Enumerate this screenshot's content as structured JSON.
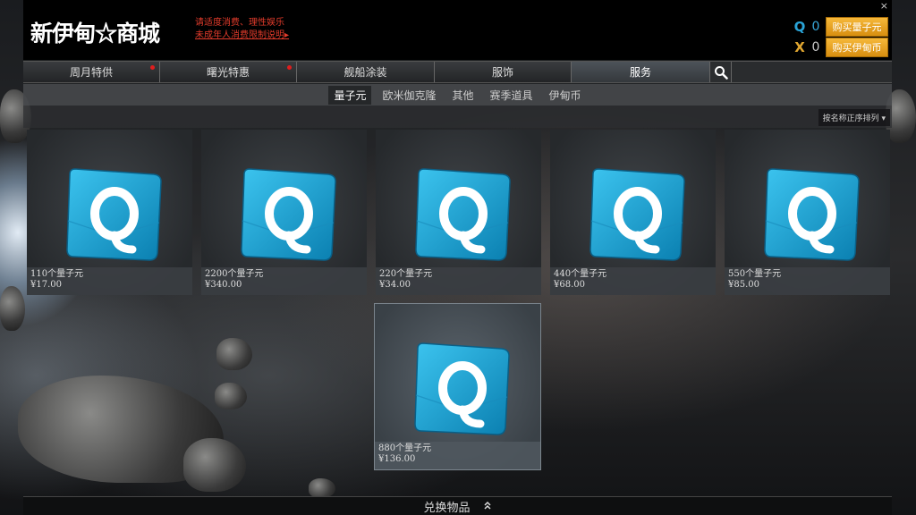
{
  "header": {
    "logo": "新伊甸☆商城",
    "notice_line1": "请适度消费、理性娱乐",
    "notice_line2": "未成年人消费限制说明",
    "notice_arrow": "▸",
    "close": "×",
    "currencies": [
      {
        "icon": "quantum-coin-icon",
        "symbol": "Q",
        "value": "0",
        "button": "购买量子元"
      },
      {
        "icon": "isk-coin-icon",
        "symbol": "X",
        "value": "0",
        "button": "购买伊甸币"
      }
    ]
  },
  "tabs": [
    {
      "label": "周月特供",
      "badge": true
    },
    {
      "label": "曙光特惠",
      "badge": true
    },
    {
      "label": "舰船涂装",
      "badge": false
    },
    {
      "label": "服饰",
      "badge": false
    },
    {
      "label": "服务",
      "badge": false,
      "active": true
    }
  ],
  "subtabs": [
    {
      "label": "量子元",
      "active": true
    },
    {
      "label": "欧米伽克隆"
    },
    {
      "label": "其他"
    },
    {
      "label": "赛季道具"
    },
    {
      "label": "伊甸币"
    }
  ],
  "sort": {
    "label": "按名称正序排列 ▾"
  },
  "products": [
    {
      "name": "110个量子元",
      "price": "¥17.00"
    },
    {
      "name": "2200个量子元",
      "price": "¥340.00"
    },
    {
      "name": "220个量子元",
      "price": "¥34.00"
    },
    {
      "name": "440个量子元",
      "price": "¥68.00"
    },
    {
      "name": "550个量子元",
      "price": "¥85.00"
    },
    {
      "name": "880个量子元",
      "price": "¥136.00",
      "selected": true
    }
  ],
  "footer": {
    "label": "兑换物品",
    "chevron": "⌃⌃"
  },
  "colors": {
    "accent": "#f0a62a",
    "badge": "#e01e1e",
    "quantum": "#2aa4d8",
    "notice": "#e23b2b"
  }
}
